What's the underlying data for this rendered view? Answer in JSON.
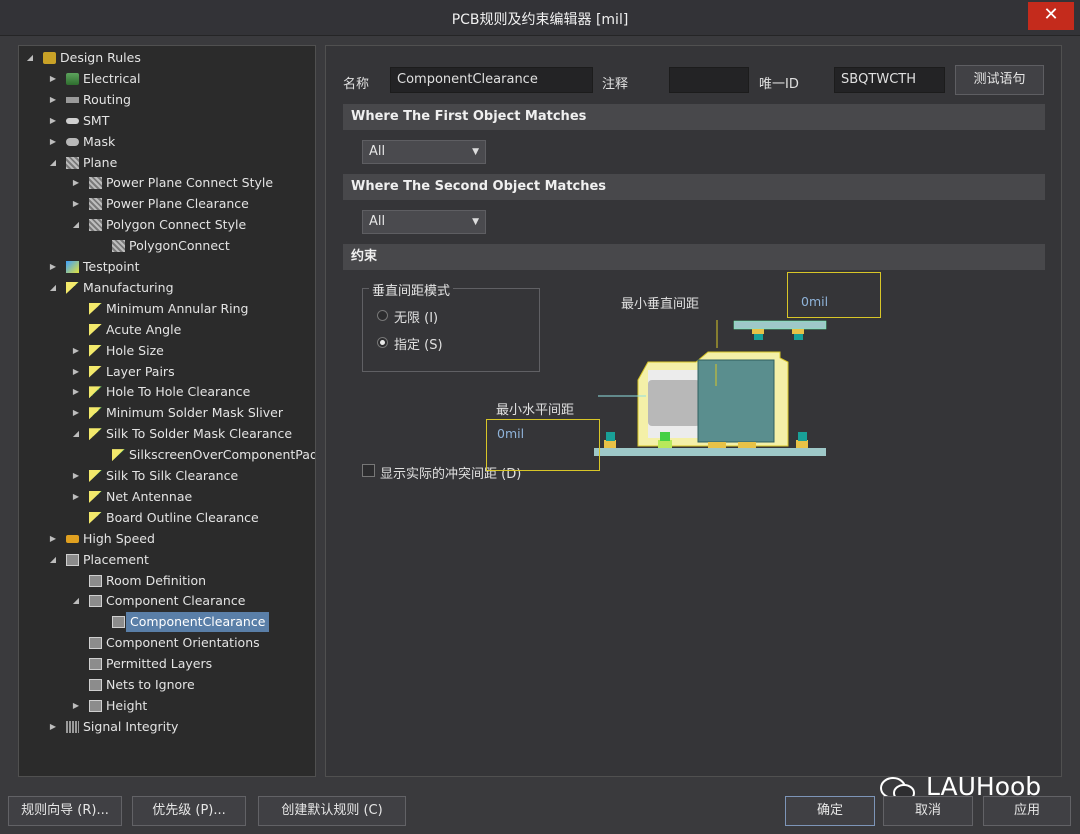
{
  "window": {
    "title": "PCB规则及约束编辑器 [mil]",
    "close_glyph": "✕"
  },
  "tree": [
    {
      "label": "Design Rules",
      "depth": 0,
      "arrow": "open",
      "icon": "folder-icon"
    },
    {
      "label": "Electrical",
      "depth": 1,
      "arrow": "closed",
      "icon": "electrical-icon"
    },
    {
      "label": "Routing",
      "depth": 1,
      "arrow": "closed",
      "icon": "routing-icon"
    },
    {
      "label": "SMT",
      "depth": 1,
      "arrow": "closed",
      "icon": "smt-icon"
    },
    {
      "label": "Mask",
      "depth": 1,
      "arrow": "closed",
      "icon": "mask-icon"
    },
    {
      "label": "Plane",
      "depth": 1,
      "arrow": "open",
      "icon": "plane-icon"
    },
    {
      "label": "Power Plane Connect Style",
      "depth": 2,
      "arrow": "closed",
      "icon": "plane-icon"
    },
    {
      "label": "Power Plane Clearance",
      "depth": 2,
      "arrow": "closed",
      "icon": "plane-icon"
    },
    {
      "label": "Polygon Connect Style",
      "depth": 2,
      "arrow": "open",
      "icon": "plane-icon"
    },
    {
      "label": "PolygonConnect",
      "depth": 3,
      "arrow": "none",
      "icon": "plane-icon"
    },
    {
      "label": "Testpoint",
      "depth": 1,
      "arrow": "closed",
      "icon": "testpoint-icon"
    },
    {
      "label": "Manufacturing",
      "depth": 1,
      "arrow": "open",
      "icon": "manufacturing-icon"
    },
    {
      "label": "Minimum Annular Ring",
      "depth": 2,
      "arrow": "none",
      "icon": "manufacturing-icon"
    },
    {
      "label": "Acute Angle",
      "depth": 2,
      "arrow": "none",
      "icon": "manufacturing-icon"
    },
    {
      "label": "Hole Size",
      "depth": 2,
      "arrow": "closed",
      "icon": "manufacturing-icon"
    },
    {
      "label": "Layer Pairs",
      "depth": 2,
      "arrow": "closed",
      "icon": "manufacturing-icon"
    },
    {
      "label": "Hole To Hole Clearance",
      "depth": 2,
      "arrow": "closed",
      "icon": "manufacturing-icon"
    },
    {
      "label": "Minimum Solder Mask Sliver",
      "depth": 2,
      "arrow": "closed",
      "icon": "manufacturing-icon"
    },
    {
      "label": "Silk To Solder Mask Clearance",
      "depth": 2,
      "arrow": "open",
      "icon": "manufacturing-icon"
    },
    {
      "label": "SilkscreenOverComponentPads",
      "depth": 3,
      "arrow": "none",
      "icon": "manufacturing-icon"
    },
    {
      "label": "Silk To Silk Clearance",
      "depth": 2,
      "arrow": "closed",
      "icon": "manufacturing-icon"
    },
    {
      "label": "Net Antennae",
      "depth": 2,
      "arrow": "closed",
      "icon": "manufacturing-icon"
    },
    {
      "label": "Board Outline Clearance",
      "depth": 2,
      "arrow": "none",
      "icon": "manufacturing-icon"
    },
    {
      "label": "High Speed",
      "depth": 1,
      "arrow": "closed",
      "icon": "high-speed-icon"
    },
    {
      "label": "Placement",
      "depth": 1,
      "arrow": "open",
      "icon": "placement-icon"
    },
    {
      "label": "Room Definition",
      "depth": 2,
      "arrow": "none",
      "icon": "placement-icon"
    },
    {
      "label": "Component Clearance",
      "depth": 2,
      "arrow": "open",
      "icon": "placement-icon"
    },
    {
      "label": "ComponentClearance",
      "depth": 3,
      "arrow": "none",
      "icon": "placement-icon",
      "selected": true
    },
    {
      "label": "Component Orientations",
      "depth": 2,
      "arrow": "none",
      "icon": "placement-icon"
    },
    {
      "label": "Permitted Layers",
      "depth": 2,
      "arrow": "none",
      "icon": "placement-icon"
    },
    {
      "label": "Nets to Ignore",
      "depth": 2,
      "arrow": "none",
      "icon": "placement-icon"
    },
    {
      "label": "Height",
      "depth": 2,
      "arrow": "closed",
      "icon": "placement-icon"
    },
    {
      "label": "Signal Integrity",
      "depth": 1,
      "arrow": "closed",
      "icon": "signal-integrity-icon"
    }
  ],
  "rule": {
    "name_label": "名称",
    "name_value": "ComponentClearance",
    "comment_label": "注释",
    "comment_value": "",
    "uid_label": "唯一ID",
    "uid_value": "SBQTWCTH",
    "test_button": "测试语句"
  },
  "first_match": {
    "header": "Where The First Object Matches",
    "value": "All"
  },
  "second_match": {
    "header": "Where The Second Object Matches",
    "value": "All"
  },
  "constraints": {
    "header": "约束",
    "vertical_mode_label": "垂直间距模式",
    "radio_infinite": "无限 (I)",
    "radio_specified": "指定 (S)",
    "selected_mode": "specified",
    "min_vertical_label": "最小垂直间距",
    "min_vertical_value": "0mil",
    "min_horizontal_label": "最小水平间距",
    "min_horizontal_value": "0mil",
    "show_actual_label": "显示实际的冲突间距 (D)",
    "show_actual_checked": false
  },
  "footer": {
    "rule_wizard": "规则向导 (R)...",
    "priority": "优先级 (P)...",
    "create_default": "创建默认规则 (C)",
    "ok": "确定",
    "cancel": "取消",
    "apply": "应用"
  },
  "watermark": "LAUHoob"
}
